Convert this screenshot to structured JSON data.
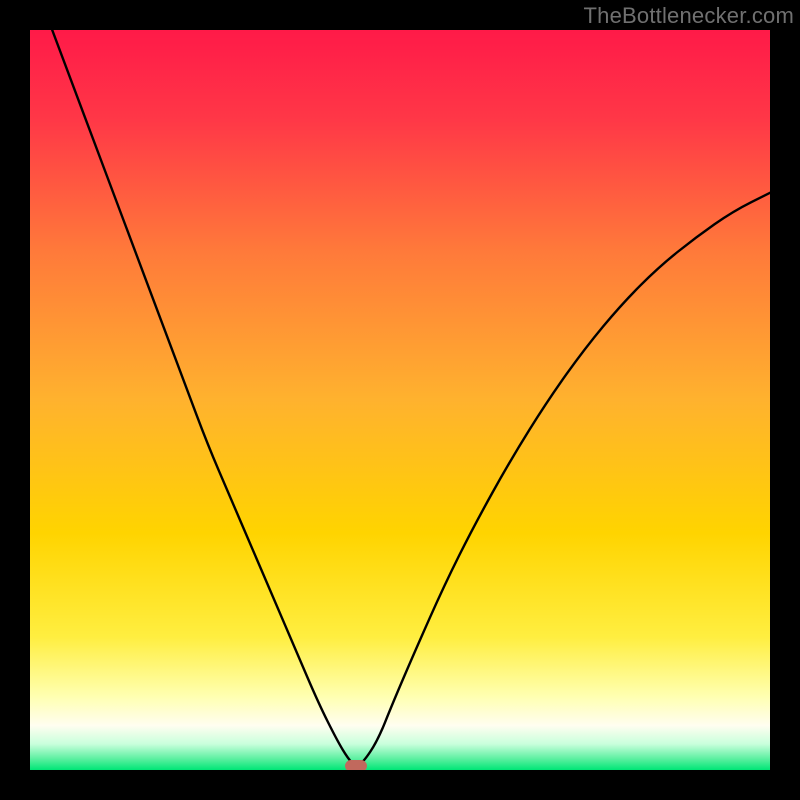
{
  "watermark": "TheBottlenecker.com",
  "chart_data": {
    "type": "line",
    "title": "",
    "xlabel": "",
    "ylabel": "",
    "xlim": [
      0,
      100
    ],
    "ylim": [
      0,
      100
    ],
    "background_gradient": {
      "top": "#ff1a48",
      "mid": "#ffd400",
      "low": "#fffef0",
      "bottom": "#00e676"
    },
    "series": [
      {
        "name": "curve",
        "x": [
          3,
          6,
          9,
          12,
          15,
          18,
          21,
          24,
          27,
          30,
          33,
          36,
          39,
          41.5,
          43,
          44,
          45,
          47,
          49,
          52,
          56,
          60,
          65,
          70,
          75,
          80,
          85,
          90,
          95,
          100
        ],
        "y": [
          100,
          92,
          84,
          76,
          68,
          60,
          52,
          44,
          37,
          30,
          23,
          16,
          9,
          4,
          1.5,
          0.5,
          1,
          4,
          9,
          16,
          25,
          33,
          42,
          50,
          57,
          63,
          68,
          72,
          75.5,
          78
        ]
      }
    ],
    "valley_marker": {
      "x": 44,
      "y": 0.5,
      "color": "#c1695d"
    }
  }
}
